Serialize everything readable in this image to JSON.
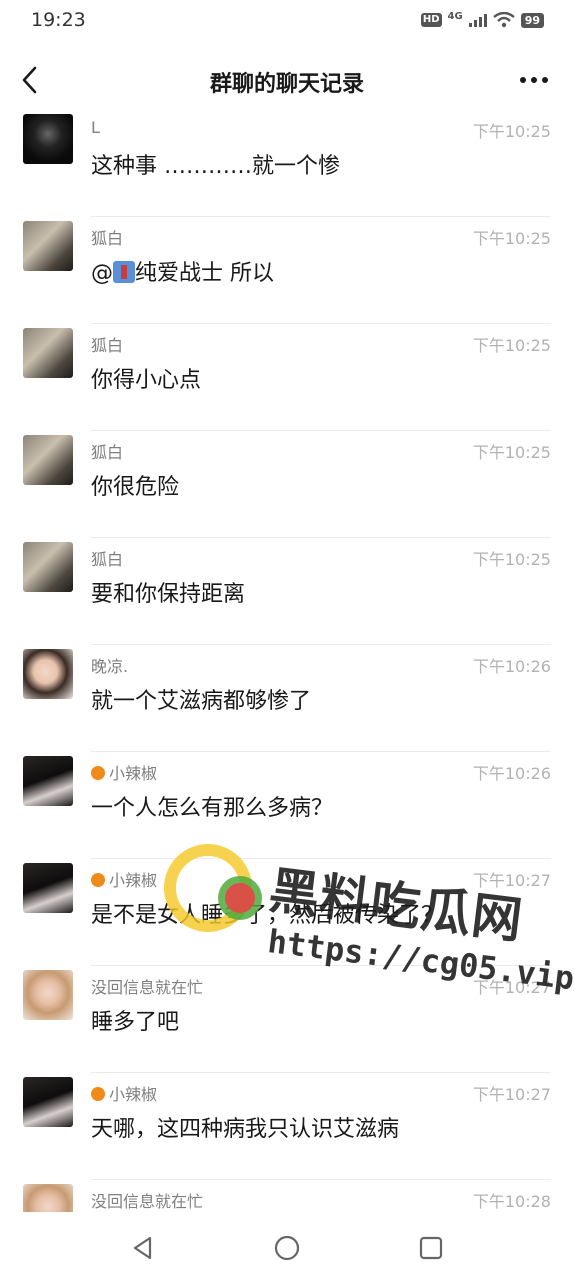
{
  "status_bar": {
    "time": "19:23",
    "hd_badge": "HD",
    "network": "4G",
    "battery": "99"
  },
  "nav": {
    "title": "群聊的聊天记录",
    "back_icon": "chevron-left-icon",
    "more_icon": "more-dots-icon"
  },
  "messages": [
    {
      "sender": "L",
      "time": "下午10:25",
      "text": "这种事 …………就一个惨",
      "avatar": "dark-figure"
    },
    {
      "sender": "狐白",
      "time": "下午10:25",
      "text_prefix": "@",
      "mention": "纯爱战士 所以",
      "mention_icon": "office-worker-emoji",
      "avatar": "cat-selfie"
    },
    {
      "sender": "狐白",
      "time": "下午10:25",
      "text": "你得小心点",
      "avatar": "cat-selfie"
    },
    {
      "sender": "狐白",
      "time": "下午10:25",
      "text": "你很危险",
      "avatar": "cat-selfie"
    },
    {
      "sender": "狐白",
      "time": "下午10:25",
      "text": "要和你保持距离",
      "avatar": "cat-selfie"
    },
    {
      "sender": "晚凉.",
      "time": "下午10:26",
      "text": "就一个艾滋病都够惨了",
      "avatar": "girl-portrait"
    },
    {
      "sender": "小辣椒",
      "sender_icon": "orange-emoji",
      "time": "下午10:26",
      "text": "一个人怎么有那么多病？",
      "avatar": "dark-hair-girl"
    },
    {
      "sender": "小辣椒",
      "sender_icon": "orange-emoji",
      "time": "下午10:27",
      "text": "是不是女人睡多了，然后被传染了？",
      "avatar": "dark-hair-girl"
    },
    {
      "sender": "没回信息就在忙",
      "time": "下午10:27",
      "text": "睡多了吧",
      "avatar": "blonde-girl"
    },
    {
      "sender": "小辣椒",
      "sender_icon": "orange-emoji",
      "time": "下午10:27",
      "text": "天哪，这四种病我只认识艾滋病",
      "avatar": "dark-hair-girl"
    },
    {
      "sender": "没回信息就在忙",
      "time": "下午10:28",
      "text": "",
      "avatar": "blonde-girl"
    }
  ],
  "watermark": {
    "title": "黑料吃瓜网",
    "url": "https://cg05.vip"
  },
  "bottom_nav": {
    "back": "triangle-back-icon",
    "home": "circle-home-icon",
    "recents": "square-recents-icon"
  },
  "colors": {
    "sender": "#7f7f7f",
    "time": "#b2b2b2",
    "text": "#191919",
    "divider": "#ebebeb"
  }
}
